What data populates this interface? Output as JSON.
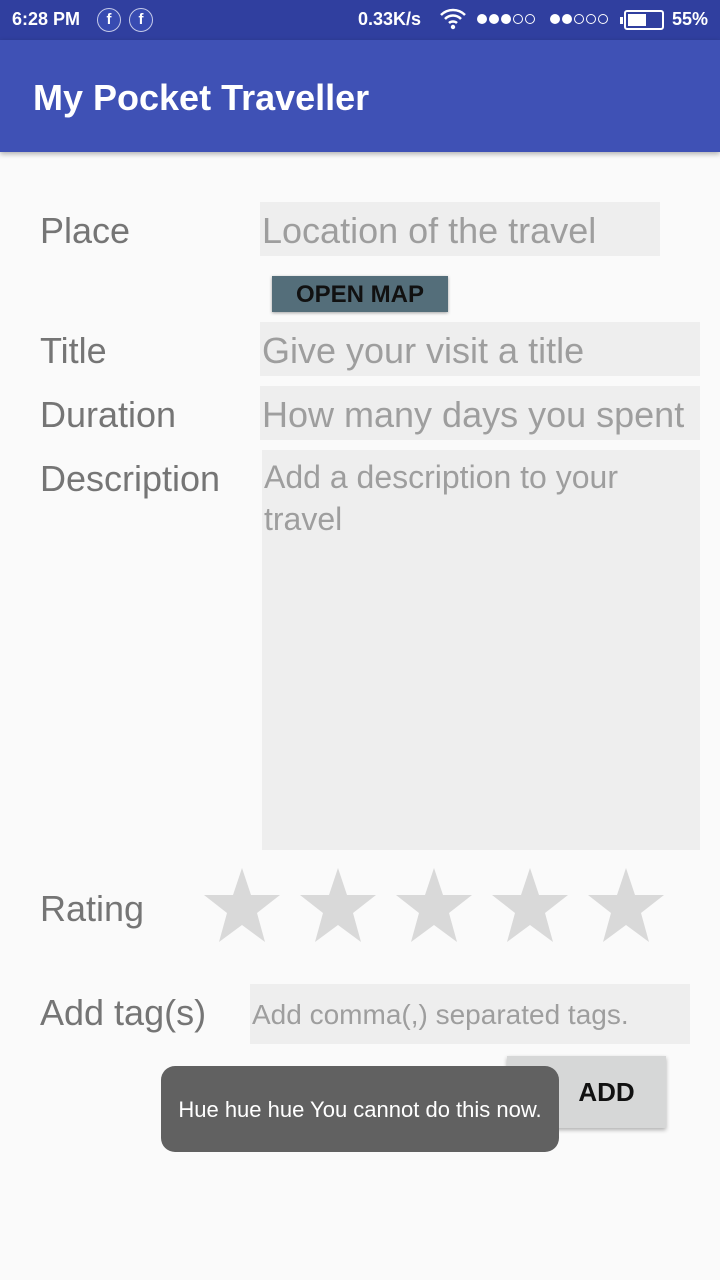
{
  "status_bar": {
    "time": "6:28 PM",
    "network_speed": "0.33K/s",
    "battery": "55%",
    "battery_level": 0.55,
    "signal1_level": 3,
    "signal2_level": 2,
    "icons": [
      "facebook-icon",
      "facebook-icon",
      "wifi-icon",
      "signal-icon",
      "signal-icon",
      "battery-icon"
    ]
  },
  "app_bar": {
    "title": "My Pocket Traveller"
  },
  "form": {
    "place_label": "Place",
    "place_placeholder": "Location of the travel",
    "open_map_button": "OPEN MAP",
    "title_label": "Title",
    "title_placeholder": "Give your visit a title",
    "duration_label": "Duration",
    "duration_placeholder": "How many days you spent",
    "description_label": "Description",
    "description_placeholder": "Add a description to your travel",
    "rating_label": "Rating",
    "rating_value": 0,
    "rating_max": 5,
    "tags_label": "Add tag(s)",
    "tags_placeholder": "Add comma(,) separated tags.",
    "add_button": "ADD"
  },
  "toast": {
    "message": "Hue hue hue You cannot do this now."
  },
  "colors": {
    "status_bar": "#303f9f",
    "app_bar": "#3f51b5",
    "open_map_button": "#546e7a",
    "star_empty": "#d9d9d9"
  }
}
